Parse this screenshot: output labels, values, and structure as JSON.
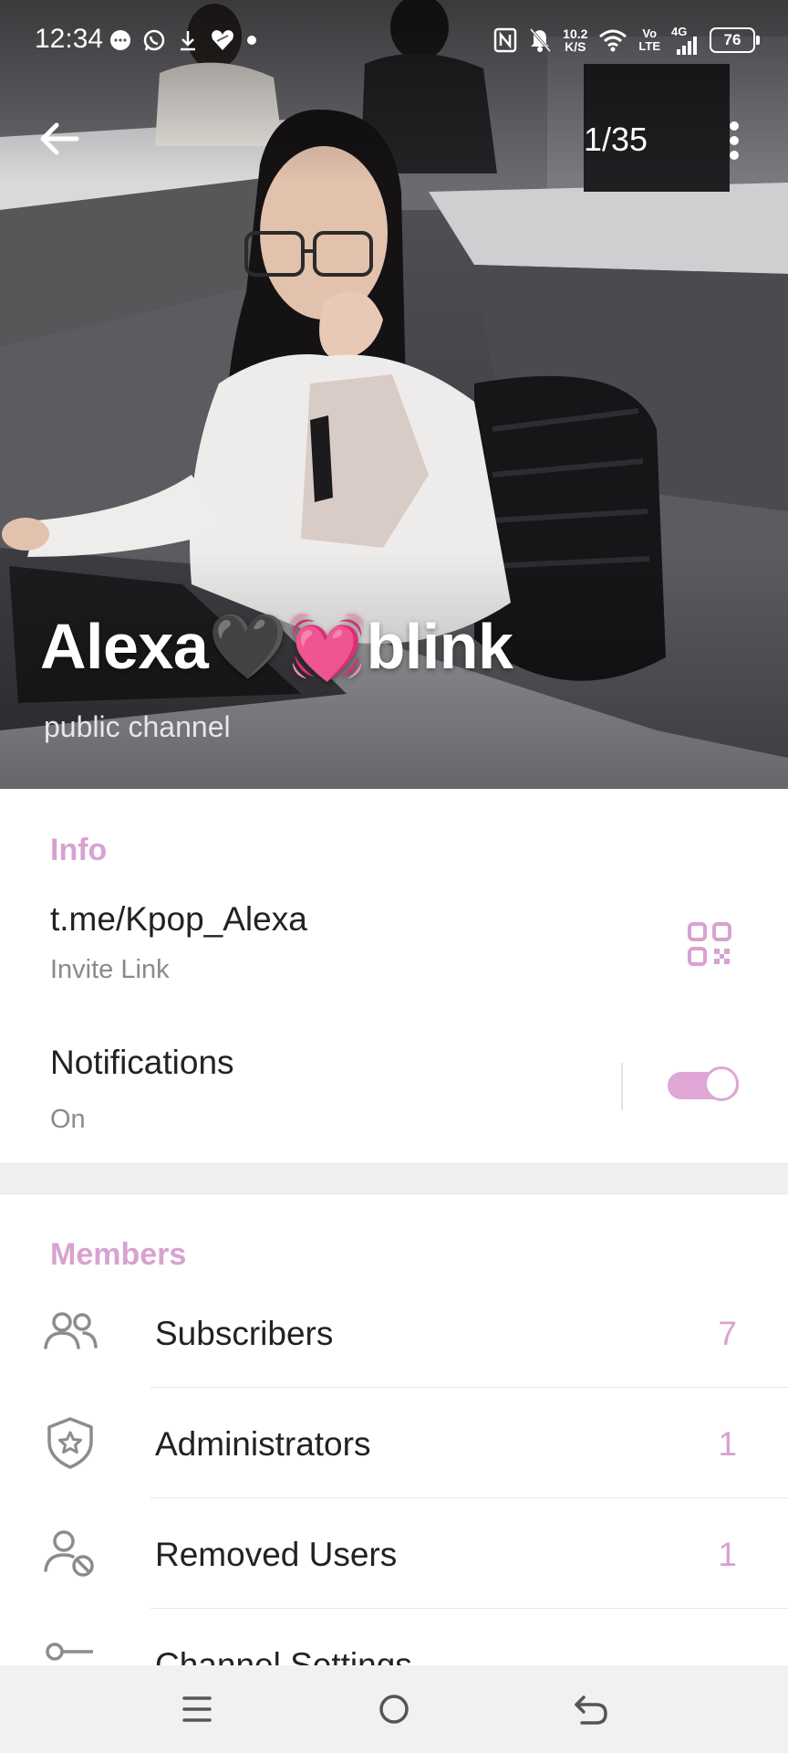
{
  "status_bar": {
    "time": "12:34",
    "net_speed_value": "10.2",
    "net_speed_unit": "K/S",
    "volte_top": "Vo",
    "volte_bottom": "LTE",
    "network": "4G",
    "battery": "76"
  },
  "header": {
    "photo_counter": "1/35",
    "channel_name": "Alexa🖤💓blink",
    "channel_type": "public channel"
  },
  "info": {
    "section_title": "Info",
    "link": "t.me/Kpop_Alexa",
    "link_caption": "Invite Link",
    "notifications_label": "Notifications",
    "notifications_state": "On",
    "notifications_enabled": true
  },
  "members": {
    "section_title": "Members",
    "items": [
      {
        "label": "Subscribers",
        "count": "7",
        "icon": "people-icon"
      },
      {
        "label": "Administrators",
        "count": "1",
        "icon": "shield-star-icon"
      },
      {
        "label": "Removed Users",
        "count": "1",
        "icon": "user-blocked-icon"
      },
      {
        "label": "Channel Settings",
        "count": "",
        "icon": "settings-icon"
      }
    ]
  },
  "colors": {
    "accent": "#d8a2d0",
    "toggle": "#dfa6d6",
    "muted_text": "#8a8a8e",
    "section_band": "#efeff1"
  },
  "nav": {
    "menu_icon": "menu-icon",
    "home_icon": "home-circle-icon",
    "back_icon": "back-arrow-icon"
  }
}
